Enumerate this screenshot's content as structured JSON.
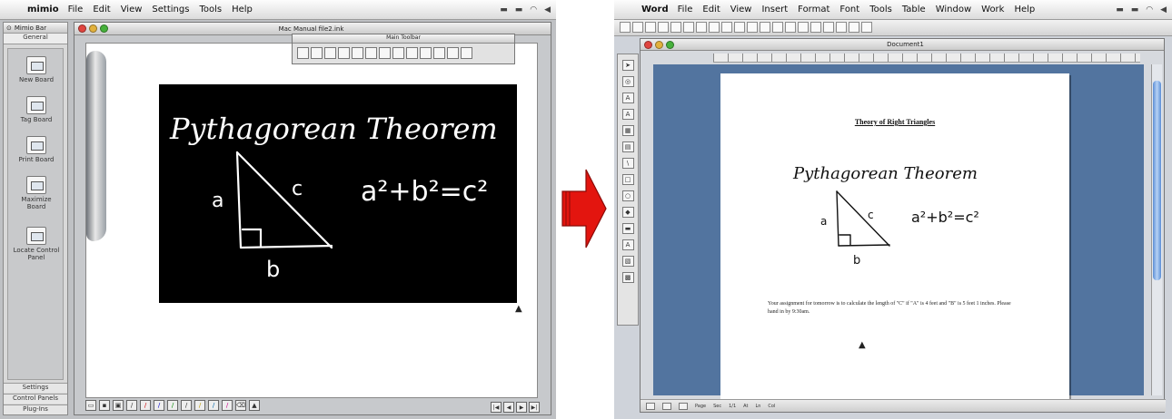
{
  "left": {
    "app_name": "mimio",
    "menu": [
      "File",
      "Edit",
      "View",
      "Settings",
      "Tools",
      "Help"
    ],
    "sidebar": {
      "title": "Mimio Bar",
      "tab": "General",
      "buttons": [
        "New Board",
        "Tag Board",
        "Print Board",
        "Maximize Board",
        "Locate Control Panel"
      ],
      "footer": [
        "Settings",
        "Control Panels",
        "Plug-Ins"
      ]
    },
    "window_title": "Mac Manual file2.ink",
    "toolbar_title": "Main Toolbar"
  },
  "right": {
    "menu": [
      "Word",
      "File",
      "Edit",
      "View",
      "Insert",
      "Format",
      "Font",
      "Tools",
      "Table",
      "Window",
      "Work",
      "Help"
    ],
    "window_title": "Document1",
    "doc_title": "Theory of Right Triangles",
    "doc_body": "Your assignment for tomorrow is to calculate the length of \"C\" if \"A\" is 4 feet and \"B\" is 5 feet 1 inches.  Please hand in by 9:30am.",
    "status": [
      "Page",
      "Sec",
      "1/1",
      "At",
      "Ln",
      "Col"
    ]
  },
  "handwriting": {
    "heading": "Pythagorean Theorem",
    "side_a": "a",
    "side_b": "b",
    "side_c": "c",
    "equation": "a²+b²=c²"
  },
  "colors": {
    "blackboard": "#000000",
    "ink_on_board": "#ffffff",
    "arrow": "#e3150f",
    "word_workspace": "#52749f"
  }
}
